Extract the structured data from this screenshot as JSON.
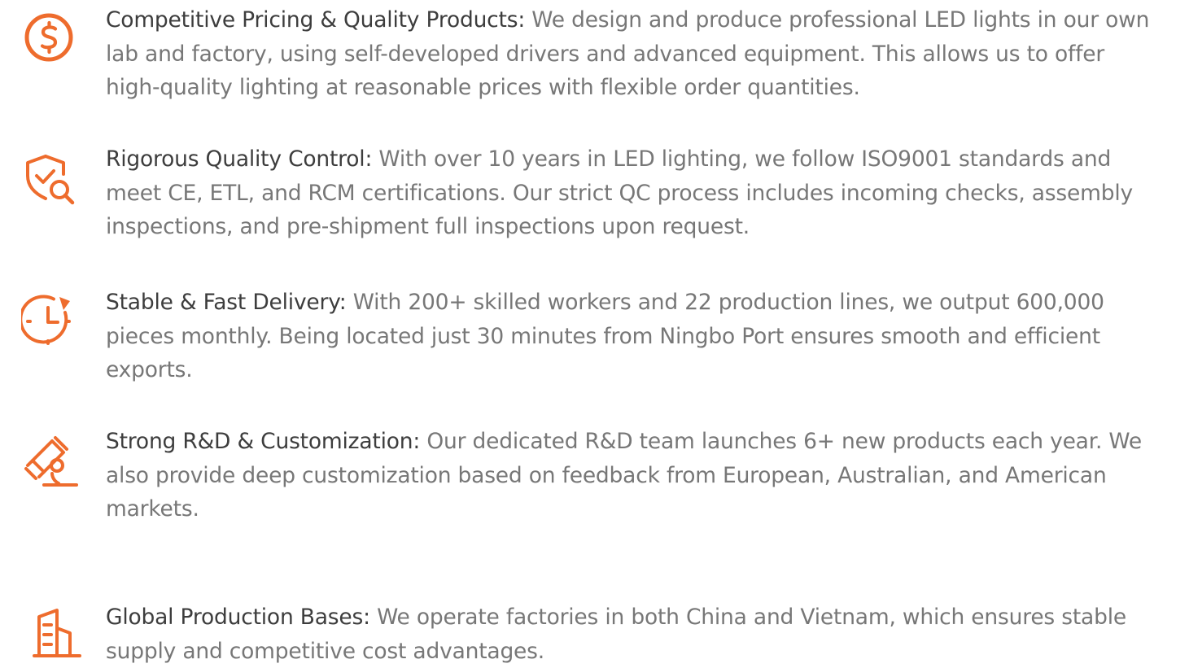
{
  "accent_color": "#ee6c2d",
  "features": [
    {
      "icon": "dollar-coin-icon",
      "title": "Competitive Pricing & Quality Products:",
      "description": " We design and produce professional LED lights in our own lab and factory, using self-developed drivers and advanced equipment. This allows us to offer high-quality lighting at reasonable prices with flexible order quantities."
    },
    {
      "icon": "shield-check-search-icon",
      "title": "Rigorous Quality Control:",
      "description": " With over 10 years in LED lighting, we follow ISO9001 standards and meet CE, ETL, and RCM certifications. Our strict QC process includes incoming checks, assembly inspections, and pre-shipment full inspections upon request."
    },
    {
      "icon": "clock-delivery-icon",
      "title": "Stable & Fast Delivery:",
      "description": " With 200+ skilled workers and 22 production lines, we output 600,000 pieces monthly. Being located just 30 minutes from Ningbo Port ensures smooth and efficient exports."
    },
    {
      "icon": "microscope-icon",
      "title": "Strong R&D & Customization:",
      "description": " Our dedicated R&D team launches 6+ new products each year. We also provide deep customization based on feedback from European, Australian, and American markets."
    },
    {
      "icon": "factory-building-icon",
      "title": "Global Production Bases:",
      "description": " We operate factories in both China and Vietnam, which ensures stable supply and competitive cost advantages."
    }
  ]
}
